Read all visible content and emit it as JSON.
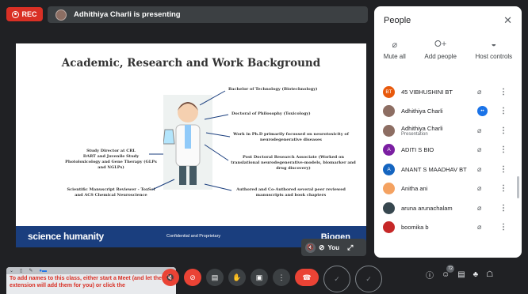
{
  "rec_label": "REC",
  "presenter_text": "Adhithiya Charli is presenting",
  "slide": {
    "title": "Academic, Research and Work Background",
    "items": [
      "Bachelor of Technology (Biotechnology)",
      "Doctoral of Philosophy (Toxicology)",
      "Work in Ph.D primarily focussed on neurotoxicity of neurodegenerative diseases",
      "Study Director at CRL",
      "DART and Juvenile Study",
      "Photoloxicology and Gene Therapy (GLPs and NGLPs)",
      "Post Doctoral Research Associate (Worked on translational neurodegenerative-models, biomarker and drug discovery)",
      "Scientific Manuscript Reviewer - ToxSci and ACS Chemical Neuroscience",
      "Authored and Co-Authored several peer reviewed manuscripts and book chapters"
    ],
    "footer_brand": "science humanity",
    "footer_conf": "Confidential and Proprietary",
    "footer_logo": "Biogen"
  },
  "selfview_label": "You",
  "panel": {
    "title": "People",
    "tools": [
      "Mute all",
      "Add people",
      "Host controls"
    ],
    "people": [
      {
        "initials": "BT",
        "name": "45 VIBHUSHINI BT",
        "color": "#e8590c"
      },
      {
        "initials": "",
        "name": "Adhithiya Charli",
        "color": "#8d6e63"
      },
      {
        "initials": "",
        "name": "Adhithiya Charli",
        "sub": "Presentation",
        "color": "#8d6e63"
      },
      {
        "initials": "A",
        "name": "ADITI S BIO",
        "color": "#7b1fa2"
      },
      {
        "initials": "A",
        "name": "ANANT S MAADHAV BT",
        "color": "#1565c0"
      },
      {
        "initials": "",
        "name": "Anitha ani",
        "color": "#f4a261"
      },
      {
        "initials": "",
        "name": "aruna arunachalam",
        "color": "#37474f"
      },
      {
        "initials": "",
        "name": "boomika b",
        "color": "#c62828"
      }
    ]
  },
  "ext_text": "To add names to this class, either start a Meet (and let the extension will add them for you) or click the",
  "participant_count": "72"
}
